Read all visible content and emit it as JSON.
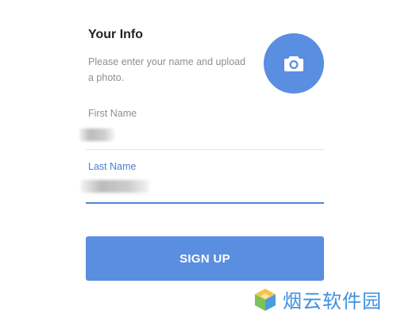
{
  "form": {
    "title": "Your Info",
    "subtitle": "Please enter your name and upload a photo.",
    "avatar_icon": "camera-icon",
    "first_name": {
      "label": "First Name",
      "value": ""
    },
    "last_name": {
      "label": "Last Name",
      "value": ""
    },
    "submit_label": "SIGN UP"
  },
  "watermark": {
    "text": "烟云软件园",
    "icon": "cube-logo-icon"
  },
  "colors": {
    "accent": "#5a8ee0",
    "label_active": "#4a7fcf",
    "label": "#8f8f8f",
    "title": "#222222"
  }
}
